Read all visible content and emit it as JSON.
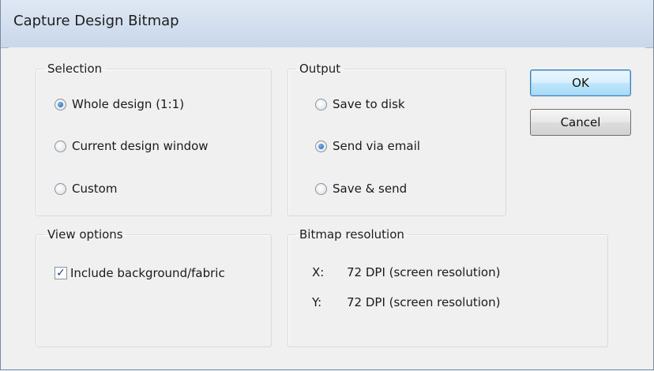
{
  "window": {
    "title": "Capture Design Bitmap"
  },
  "selection": {
    "legend": "Selection",
    "options": [
      {
        "label": "Whole design (1:1)",
        "checked": true
      },
      {
        "label": "Current design window",
        "checked": false
      },
      {
        "label": "Custom",
        "checked": false
      }
    ]
  },
  "output": {
    "legend": "Output",
    "options": [
      {
        "label": "Save to disk",
        "checked": false
      },
      {
        "label": "Send via email",
        "checked": true
      },
      {
        "label": "Save & send",
        "checked": false
      }
    ]
  },
  "view_options": {
    "legend": "View options",
    "include_background": {
      "label": "Include background/fabric",
      "checked": true
    }
  },
  "bitmap_resolution": {
    "legend": "Bitmap resolution",
    "x": {
      "axis": "X:",
      "value": "72 DPI (screen resolution)"
    },
    "y": {
      "axis": "Y:",
      "value": "72 DPI (screen resolution)"
    }
  },
  "buttons": {
    "ok": "OK",
    "cancel": "Cancel"
  },
  "icons": {
    "radio": "radio-button",
    "checkbox": "checkbox-check-icon"
  }
}
